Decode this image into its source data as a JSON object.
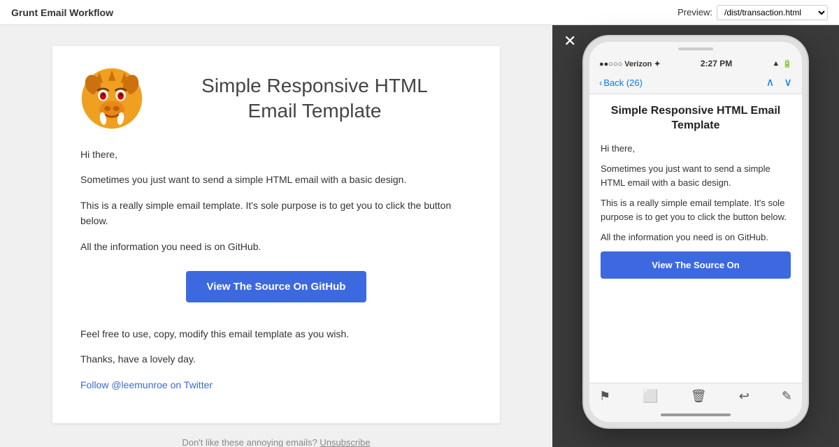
{
  "topbar": {
    "title": "Grunt Email Workflow",
    "preview_label": "Preview:",
    "preview_value": "/dist/transaction.html"
  },
  "email": {
    "title_line1": "Simple Responsive HTML",
    "title_line2": "Email Template",
    "greeting": "Hi there,",
    "para1": "Sometimes you just want to send a simple HTML email with a basic design.",
    "para2": "This is a really simple email template. It's sole purpose is to get you to click the button below.",
    "para3": "All the information you need is on GitHub.",
    "cta_button": "View The Source On GitHub",
    "para4": "Feel free to use, copy, modify this email template as you wish.",
    "para5": "Thanks, have a lovely day.",
    "twitter_link": "Follow @leemunroe on Twitter",
    "footer_text": "Don't like these annoying emails?",
    "unsub_link": "Unsubscribe"
  },
  "phone": {
    "carrier": "●●○○○ Verizon ✦",
    "time": "2:27 PM",
    "signal": "▲ 🔋",
    "back_label": "Back (26)",
    "email_title": "Simple Responsive HTML Email Template",
    "greeting": "Hi there,",
    "para1": "Sometimes you just want to send a simple HTML email with a basic design.",
    "para2": "This is a really simple email template. It's sole purpose is to get you to click the button below.",
    "para3": "All the information you need is on GitHub.",
    "cta_button": "View The Source On"
  },
  "colors": {
    "cta_bg": "#3d69e0",
    "link_color": "#3d69e0"
  }
}
